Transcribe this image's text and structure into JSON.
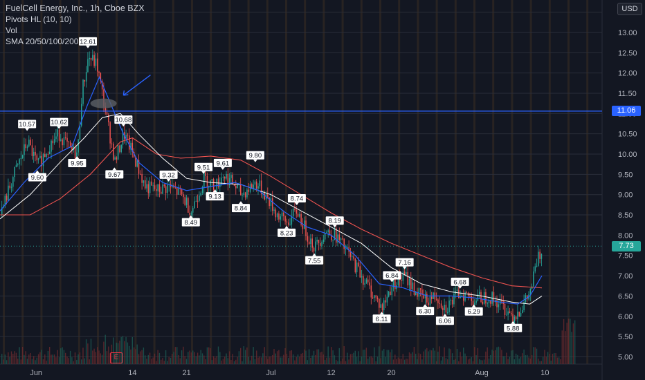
{
  "legend": {
    "title": "FuelCell Energy, Inc., 1h, Cboe BZX",
    "pivots": "Pivots HL (10, 10)",
    "vol": "Vol",
    "sma": "SMA 20/50/100/200"
  },
  "currency": "USD",
  "earnings_marker": "E",
  "horizontal_line": {
    "label": "11.06",
    "color": "#2962ff"
  },
  "last_price": {
    "label": "7.73",
    "color": "#26a69a"
  },
  "colors": {
    "up": "#26a69a",
    "down": "#ef5350",
    "sma20": "#2962ff",
    "sma50": "#ffffff",
    "sma100": "#ef5350",
    "grid_alt": "#4b3a2a"
  },
  "chart_data": {
    "type": "candlestick",
    "ylim": [
      4.82,
      13.8
    ],
    "yticks": [
      "13.50",
      "13.00",
      "12.50",
      "12.00",
      "11.50",
      "11.00",
      "10.50",
      "10.00",
      "9.50",
      "9.00",
      "8.50",
      "8.00",
      "7.50",
      "7.00",
      "6.50",
      "6.00",
      "5.50",
      "5.00"
    ],
    "xticks": [
      {
        "label": "Jun",
        "t": 0.06
      },
      {
        "label": "14",
        "t": 0.22
      },
      {
        "label": "21",
        "t": 0.31
      },
      {
        "label": "Jul",
        "t": 0.45
      },
      {
        "label": "12",
        "t": 0.55
      },
      {
        "label": "20",
        "t": 0.65
      },
      {
        "label": "Aug",
        "t": 0.8
      },
      {
        "label": "10",
        "t": 0.905
      }
    ],
    "pivots": [
      {
        "label": "12.61",
        "t": 0.146,
        "price": 12.61,
        "type": "high"
      },
      {
        "label": "10.57",
        "t": 0.045,
        "price": 10.57,
        "type": "high"
      },
      {
        "label": "10.62",
        "t": 0.098,
        "price": 10.62,
        "type": "high"
      },
      {
        "label": "10.68",
        "t": 0.205,
        "price": 10.68,
        "type": "high"
      },
      {
        "label": "9.51",
        "t": 0.338,
        "price": 9.51,
        "type": "high"
      },
      {
        "label": "9.61",
        "t": 0.37,
        "price": 9.61,
        "type": "high"
      },
      {
        "label": "9.80",
        "t": 0.424,
        "price": 9.8,
        "type": "high"
      },
      {
        "label": "9.32",
        "t": 0.28,
        "price": 9.32,
        "type": "high"
      },
      {
        "label": "8.74",
        "t": 0.493,
        "price": 8.74,
        "type": "high"
      },
      {
        "label": "8.19",
        "t": 0.556,
        "price": 8.19,
        "type": "high"
      },
      {
        "label": "7.16",
        "t": 0.672,
        "price": 7.16,
        "type": "high"
      },
      {
        "label": "6.84",
        "t": 0.651,
        "price": 6.84,
        "type": "high"
      },
      {
        "label": "6.68",
        "t": 0.764,
        "price": 6.68,
        "type": "high"
      },
      {
        "label": "9.60",
        "t": 0.062,
        "price": 9.6,
        "type": "low"
      },
      {
        "label": "9.95",
        "t": 0.128,
        "price": 9.95,
        "type": "low"
      },
      {
        "label": "9.67",
        "t": 0.19,
        "price": 9.67,
        "type": "low"
      },
      {
        "label": "9.13",
        "t": 0.357,
        "price": 9.13,
        "type": "low"
      },
      {
        "label": "8.84",
        "t": 0.4,
        "price": 8.84,
        "type": "low"
      },
      {
        "label": "8.49",
        "t": 0.317,
        "price": 8.49,
        "type": "low"
      },
      {
        "label": "8.23",
        "t": 0.476,
        "price": 8.23,
        "type": "low"
      },
      {
        "label": "7.55",
        "t": 0.522,
        "price": 7.55,
        "type": "low"
      },
      {
        "label": "6.11",
        "t": 0.634,
        "price": 6.11,
        "type": "low"
      },
      {
        "label": "6.30",
        "t": 0.706,
        "price": 6.3,
        "type": "low"
      },
      {
        "label": "6.06",
        "t": 0.739,
        "price": 6.06,
        "type": "low"
      },
      {
        "label": "6.29",
        "t": 0.787,
        "price": 6.29,
        "type": "low"
      },
      {
        "label": "5.88",
        "t": 0.852,
        "price": 5.88,
        "type": "low"
      }
    ],
    "price_path": [
      [
        0.0,
        8.5
      ],
      [
        0.02,
        9.4
      ],
      [
        0.045,
        10.3
      ],
      [
        0.062,
        9.7
      ],
      [
        0.08,
        10.2
      ],
      [
        0.098,
        10.5
      ],
      [
        0.115,
        10.1
      ],
      [
        0.128,
        10.0
      ],
      [
        0.135,
        11.5
      ],
      [
        0.146,
        12.4
      ],
      [
        0.16,
        12.2
      ],
      [
        0.175,
        11.0
      ],
      [
        0.19,
        9.8
      ],
      [
        0.205,
        10.5
      ],
      [
        0.22,
        10.0
      ],
      [
        0.24,
        9.2
      ],
      [
        0.26,
        9.1
      ],
      [
        0.28,
        9.2
      ],
      [
        0.3,
        9.0
      ],
      [
        0.317,
        8.6
      ],
      [
        0.338,
        9.4
      ],
      [
        0.357,
        9.2
      ],
      [
        0.37,
        9.5
      ],
      [
        0.385,
        9.3
      ],
      [
        0.4,
        9.0
      ],
      [
        0.424,
        9.3
      ],
      [
        0.44,
        9.0
      ],
      [
        0.46,
        8.5
      ],
      [
        0.476,
        8.3
      ],
      [
        0.493,
        8.6
      ],
      [
        0.51,
        8.0
      ],
      [
        0.522,
        7.7
      ],
      [
        0.54,
        8.1
      ],
      [
        0.556,
        8.0
      ],
      [
        0.575,
        7.6
      ],
      [
        0.6,
        7.0
      ],
      [
        0.62,
        6.5
      ],
      [
        0.634,
        6.2
      ],
      [
        0.651,
        6.8
      ],
      [
        0.672,
        7.0
      ],
      [
        0.69,
        6.6
      ],
      [
        0.706,
        6.4
      ],
      [
        0.725,
        6.5
      ],
      [
        0.739,
        6.2
      ],
      [
        0.764,
        6.6
      ],
      [
        0.787,
        6.4
      ],
      [
        0.81,
        6.5
      ],
      [
        0.83,
        6.3
      ],
      [
        0.852,
        6.0
      ],
      [
        0.87,
        6.3
      ],
      [
        0.88,
        6.6
      ],
      [
        0.89,
        7.3
      ],
      [
        0.895,
        7.5
      ],
      [
        0.9,
        7.6
      ]
    ],
    "sma20": [
      [
        0.0,
        8.6
      ],
      [
        0.04,
        9.3
      ],
      [
        0.08,
        9.9
      ],
      [
        0.12,
        10.2
      ],
      [
        0.145,
        11.2
      ],
      [
        0.165,
        11.9
      ],
      [
        0.185,
        11.2
      ],
      [
        0.205,
        10.5
      ],
      [
        0.23,
        9.8
      ],
      [
        0.27,
        9.3
      ],
      [
        0.31,
        9.1
      ],
      [
        0.35,
        9.2
      ],
      [
        0.39,
        9.3
      ],
      [
        0.43,
        9.1
      ],
      [
        0.47,
        8.6
      ],
      [
        0.51,
        8.2
      ],
      [
        0.55,
        8.0
      ],
      [
        0.59,
        7.5
      ],
      [
        0.63,
        6.8
      ],
      [
        0.67,
        6.7
      ],
      [
        0.71,
        6.5
      ],
      [
        0.75,
        6.5
      ],
      [
        0.79,
        6.45
      ],
      [
        0.83,
        6.35
      ],
      [
        0.86,
        6.3
      ],
      [
        0.88,
        6.5
      ],
      [
        0.9,
        7.0
      ]
    ],
    "sma50": [
      [
        0.0,
        8.4
      ],
      [
        0.05,
        9.0
      ],
      [
        0.1,
        9.8
      ],
      [
        0.14,
        10.4
      ],
      [
        0.17,
        10.9
      ],
      [
        0.2,
        11.0
      ],
      [
        0.23,
        10.5
      ],
      [
        0.27,
        9.9
      ],
      [
        0.31,
        9.4
      ],
      [
        0.35,
        9.3
      ],
      [
        0.4,
        9.25
      ],
      [
        0.45,
        9.0
      ],
      [
        0.5,
        8.6
      ],
      [
        0.55,
        8.2
      ],
      [
        0.6,
        7.8
      ],
      [
        0.65,
        7.2
      ],
      [
        0.7,
        6.8
      ],
      [
        0.75,
        6.6
      ],
      [
        0.8,
        6.5
      ],
      [
        0.85,
        6.35
      ],
      [
        0.88,
        6.3
      ],
      [
        0.9,
        6.5
      ]
    ],
    "sma100": [
      [
        0.0,
        8.5
      ],
      [
        0.05,
        8.5
      ],
      [
        0.1,
        8.9
      ],
      [
        0.15,
        9.5
      ],
      [
        0.2,
        10.3
      ],
      [
        0.22,
        10.4
      ],
      [
        0.26,
        10.0
      ],
      [
        0.3,
        9.9
      ],
      [
        0.35,
        9.95
      ],
      [
        0.4,
        9.85
      ],
      [
        0.45,
        9.45
      ],
      [
        0.5,
        9.0
      ],
      [
        0.55,
        8.55
      ],
      [
        0.6,
        8.15
      ],
      [
        0.65,
        7.8
      ],
      [
        0.7,
        7.5
      ],
      [
        0.75,
        7.2
      ],
      [
        0.8,
        6.95
      ],
      [
        0.85,
        6.75
      ],
      [
        0.9,
        6.7
      ]
    ]
  }
}
